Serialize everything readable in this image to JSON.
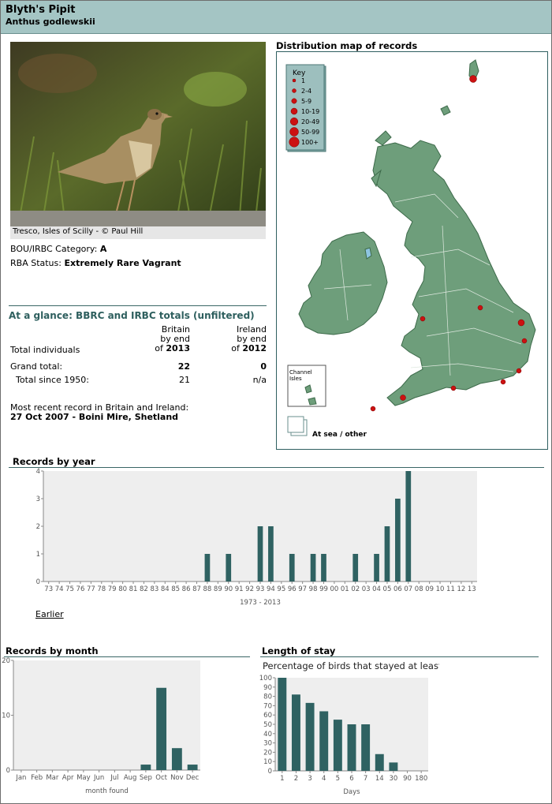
{
  "header": {
    "common_name": "Blyth's Pipit",
    "scientific_name": "Anthus godlewskii"
  },
  "photo": {
    "caption": "Tresco, Isles of Scilly - © Paul Hill"
  },
  "status": {
    "category_label": "BOU/IRBC Category:",
    "category_value": "A",
    "rba_label": "RBA Status:",
    "rba_value": "Extremely Rare Vagrant"
  },
  "glance": {
    "title": "At a glance: BBRC and IRBC totals (unfiltered)",
    "col_britain": [
      "Britain",
      "by end",
      "of"
    ],
    "britain_year": "2013",
    "col_ireland": [
      "Ireland",
      "by end",
      "of"
    ],
    "ireland_year": "2012",
    "row_total_individuals": "Total individuals",
    "row_grand_total": "Grand total:",
    "grand_total_britain": "22",
    "grand_total_ireland": "0",
    "row_since_1950": "Total since 1950:",
    "since_1950_britain": "21",
    "since_1950_ireland": "n/a",
    "recent_label": "Most recent record in Britain and Ireland:",
    "recent_value": "27 Oct 2007 - Boini Mire, Shetland"
  },
  "map": {
    "title": "Distribution map of records",
    "key_title": "Key",
    "key_items": [
      "1",
      "2-4",
      "5-9",
      "10-19",
      "20-49",
      "50-99",
      "100+"
    ],
    "channel_label": [
      "Channel",
      "Isles"
    ],
    "at_sea_label": "At sea / other",
    "land_color": "#6e9e7b",
    "dot_color": "#cc1111"
  },
  "sections": {
    "by_year": "Records by year",
    "by_month": "Records by month",
    "stay": "Length of stay",
    "earlier_link": "Earlier"
  },
  "chart_data": [
    {
      "type": "bar",
      "title": "Records by year",
      "xlabel": "1973 - 2013",
      "ylabel": "",
      "ylim": [
        0,
        4
      ],
      "yticks": [
        0,
        1,
        2,
        3,
        4
      ],
      "categories": [
        "73",
        "74",
        "75",
        "76",
        "77",
        "78",
        "79",
        "80",
        "81",
        "82",
        "83",
        "84",
        "85",
        "86",
        "87",
        "88",
        "89",
        "90",
        "91",
        "92",
        "93",
        "94",
        "95",
        "96",
        "97",
        "98",
        "99",
        "00",
        "01",
        "02",
        "03",
        "04",
        "05",
        "06",
        "07",
        "08",
        "09",
        "10",
        "11",
        "12",
        "13"
      ],
      "values": [
        0,
        0,
        0,
        0,
        0,
        0,
        0,
        0,
        0,
        0,
        0,
        0,
        0,
        0,
        0,
        1,
        0,
        1,
        0,
        0,
        2,
        2,
        0,
        1,
        0,
        1,
        1,
        0,
        0,
        1,
        0,
        1,
        2,
        3,
        4,
        0,
        0,
        0,
        0,
        0,
        0
      ],
      "bar_color": "#2f6262",
      "grid": false
    },
    {
      "type": "bar",
      "title": "Records by month",
      "xlabel": "month found",
      "ylabel": "",
      "ylim": [
        0,
        20
      ],
      "yticks": [
        0,
        10,
        20
      ],
      "categories": [
        "Jan",
        "Feb",
        "Mar",
        "Apr",
        "May",
        "Jun",
        "Jul",
        "Aug",
        "Sep",
        "Oct",
        "Nov",
        "Dec"
      ],
      "values": [
        0,
        0,
        0,
        0,
        0,
        0,
        0,
        0,
        1,
        15,
        4,
        1
      ],
      "bar_color": "#2f6262",
      "grid": false
    },
    {
      "type": "bar",
      "title": "Percentage of birds that stayed at least...",
      "xlabel": "Days",
      "ylabel": "",
      "ylim": [
        0,
        100
      ],
      "yticks": [
        0,
        10,
        20,
        30,
        40,
        50,
        60,
        70,
        80,
        90,
        100
      ],
      "categories": [
        "1",
        "2",
        "3",
        "4",
        "5",
        "6",
        "7",
        "14",
        "30",
        "90",
        "180"
      ],
      "values": [
        100,
        82,
        73,
        64,
        55,
        50,
        50,
        18,
        9,
        0,
        0
      ],
      "bar_color": "#2f6262",
      "grid": false
    }
  ]
}
